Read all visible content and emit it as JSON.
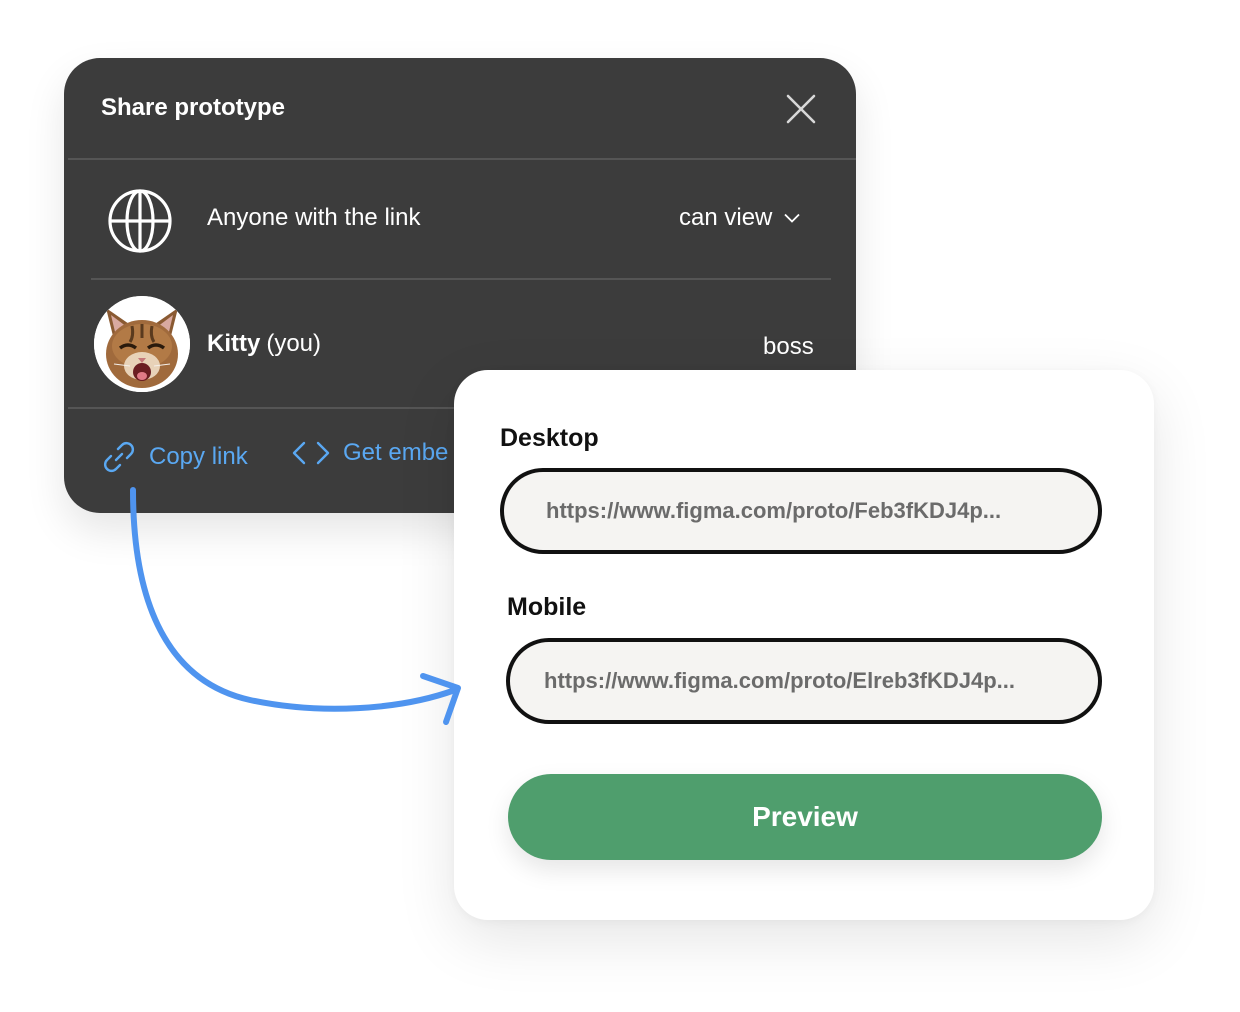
{
  "share_dialog": {
    "title": "Share prototype",
    "link_access": {
      "label": "Anyone with the link",
      "permission": "can view"
    },
    "user": {
      "name": "Kitty",
      "suffix": "(you)",
      "role": "boss"
    },
    "actions": {
      "copy_link": "Copy link",
      "get_embed": "Get embe"
    }
  },
  "link_card": {
    "desktop": {
      "label": "Desktop",
      "url": "https://www.figma.com/proto/Feb3fKDJ4p..."
    },
    "mobile": {
      "label": "Mobile",
      "url": "https://www.figma.com/proto/Elreb3fKDJ4p..."
    },
    "preview_label": "Preview"
  },
  "colors": {
    "dialog_bg": "#3c3c3c",
    "link_accent": "#5aa8f2",
    "arrow": "#4f94ef",
    "preview_bg": "#4f9e6d"
  },
  "icons": [
    "close-icon",
    "globe-icon",
    "chevron-down-icon",
    "link-icon",
    "code-icon",
    "avatar-kitten",
    "curved-arrow"
  ]
}
